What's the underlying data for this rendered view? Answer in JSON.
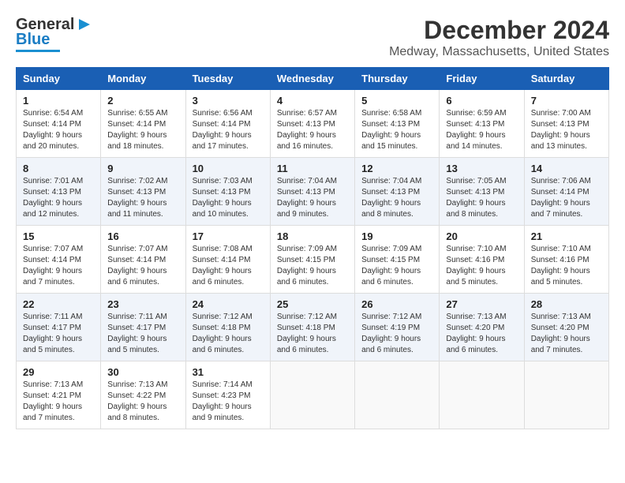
{
  "header": {
    "logo_general": "General",
    "logo_blue": "Blue",
    "title": "December 2024",
    "subtitle": "Medway, Massachusetts, United States"
  },
  "days_of_week": [
    "Sunday",
    "Monday",
    "Tuesday",
    "Wednesday",
    "Thursday",
    "Friday",
    "Saturday"
  ],
  "weeks": [
    [
      {
        "day": "1",
        "sunrise": "Sunrise: 6:54 AM",
        "sunset": "Sunset: 4:14 PM",
        "daylight": "Daylight: 9 hours and 20 minutes."
      },
      {
        "day": "2",
        "sunrise": "Sunrise: 6:55 AM",
        "sunset": "Sunset: 4:14 PM",
        "daylight": "Daylight: 9 hours and 18 minutes."
      },
      {
        "day": "3",
        "sunrise": "Sunrise: 6:56 AM",
        "sunset": "Sunset: 4:14 PM",
        "daylight": "Daylight: 9 hours and 17 minutes."
      },
      {
        "day": "4",
        "sunrise": "Sunrise: 6:57 AM",
        "sunset": "Sunset: 4:13 PM",
        "daylight": "Daylight: 9 hours and 16 minutes."
      },
      {
        "day": "5",
        "sunrise": "Sunrise: 6:58 AM",
        "sunset": "Sunset: 4:13 PM",
        "daylight": "Daylight: 9 hours and 15 minutes."
      },
      {
        "day": "6",
        "sunrise": "Sunrise: 6:59 AM",
        "sunset": "Sunset: 4:13 PM",
        "daylight": "Daylight: 9 hours and 14 minutes."
      },
      {
        "day": "7",
        "sunrise": "Sunrise: 7:00 AM",
        "sunset": "Sunset: 4:13 PM",
        "daylight": "Daylight: 9 hours and 13 minutes."
      }
    ],
    [
      {
        "day": "8",
        "sunrise": "Sunrise: 7:01 AM",
        "sunset": "Sunset: 4:13 PM",
        "daylight": "Daylight: 9 hours and 12 minutes."
      },
      {
        "day": "9",
        "sunrise": "Sunrise: 7:02 AM",
        "sunset": "Sunset: 4:13 PM",
        "daylight": "Daylight: 9 hours and 11 minutes."
      },
      {
        "day": "10",
        "sunrise": "Sunrise: 7:03 AM",
        "sunset": "Sunset: 4:13 PM",
        "daylight": "Daylight: 9 hours and 10 minutes."
      },
      {
        "day": "11",
        "sunrise": "Sunrise: 7:04 AM",
        "sunset": "Sunset: 4:13 PM",
        "daylight": "Daylight: 9 hours and 9 minutes."
      },
      {
        "day": "12",
        "sunrise": "Sunrise: 7:04 AM",
        "sunset": "Sunset: 4:13 PM",
        "daylight": "Daylight: 9 hours and 8 minutes."
      },
      {
        "day": "13",
        "sunrise": "Sunrise: 7:05 AM",
        "sunset": "Sunset: 4:13 PM",
        "daylight": "Daylight: 9 hours and 8 minutes."
      },
      {
        "day": "14",
        "sunrise": "Sunrise: 7:06 AM",
        "sunset": "Sunset: 4:14 PM",
        "daylight": "Daylight: 9 hours and 7 minutes."
      }
    ],
    [
      {
        "day": "15",
        "sunrise": "Sunrise: 7:07 AM",
        "sunset": "Sunset: 4:14 PM",
        "daylight": "Daylight: 9 hours and 7 minutes."
      },
      {
        "day": "16",
        "sunrise": "Sunrise: 7:07 AM",
        "sunset": "Sunset: 4:14 PM",
        "daylight": "Daylight: 9 hours and 6 minutes."
      },
      {
        "day": "17",
        "sunrise": "Sunrise: 7:08 AM",
        "sunset": "Sunset: 4:14 PM",
        "daylight": "Daylight: 9 hours and 6 minutes."
      },
      {
        "day": "18",
        "sunrise": "Sunrise: 7:09 AM",
        "sunset": "Sunset: 4:15 PM",
        "daylight": "Daylight: 9 hours and 6 minutes."
      },
      {
        "day": "19",
        "sunrise": "Sunrise: 7:09 AM",
        "sunset": "Sunset: 4:15 PM",
        "daylight": "Daylight: 9 hours and 6 minutes."
      },
      {
        "day": "20",
        "sunrise": "Sunrise: 7:10 AM",
        "sunset": "Sunset: 4:16 PM",
        "daylight": "Daylight: 9 hours and 5 minutes."
      },
      {
        "day": "21",
        "sunrise": "Sunrise: 7:10 AM",
        "sunset": "Sunset: 4:16 PM",
        "daylight": "Daylight: 9 hours and 5 minutes."
      }
    ],
    [
      {
        "day": "22",
        "sunrise": "Sunrise: 7:11 AM",
        "sunset": "Sunset: 4:17 PM",
        "daylight": "Daylight: 9 hours and 5 minutes."
      },
      {
        "day": "23",
        "sunrise": "Sunrise: 7:11 AM",
        "sunset": "Sunset: 4:17 PM",
        "daylight": "Daylight: 9 hours and 5 minutes."
      },
      {
        "day": "24",
        "sunrise": "Sunrise: 7:12 AM",
        "sunset": "Sunset: 4:18 PM",
        "daylight": "Daylight: 9 hours and 6 minutes."
      },
      {
        "day": "25",
        "sunrise": "Sunrise: 7:12 AM",
        "sunset": "Sunset: 4:18 PM",
        "daylight": "Daylight: 9 hours and 6 minutes."
      },
      {
        "day": "26",
        "sunrise": "Sunrise: 7:12 AM",
        "sunset": "Sunset: 4:19 PM",
        "daylight": "Daylight: 9 hours and 6 minutes."
      },
      {
        "day": "27",
        "sunrise": "Sunrise: 7:13 AM",
        "sunset": "Sunset: 4:20 PM",
        "daylight": "Daylight: 9 hours and 6 minutes."
      },
      {
        "day": "28",
        "sunrise": "Sunrise: 7:13 AM",
        "sunset": "Sunset: 4:20 PM",
        "daylight": "Daylight: 9 hours and 7 minutes."
      }
    ],
    [
      {
        "day": "29",
        "sunrise": "Sunrise: 7:13 AM",
        "sunset": "Sunset: 4:21 PM",
        "daylight": "Daylight: 9 hours and 7 minutes."
      },
      {
        "day": "30",
        "sunrise": "Sunrise: 7:13 AM",
        "sunset": "Sunset: 4:22 PM",
        "daylight": "Daylight: 9 hours and 8 minutes."
      },
      {
        "day": "31",
        "sunrise": "Sunrise: 7:14 AM",
        "sunset": "Sunset: 4:23 PM",
        "daylight": "Daylight: 9 hours and 9 minutes."
      },
      null,
      null,
      null,
      null
    ]
  ]
}
